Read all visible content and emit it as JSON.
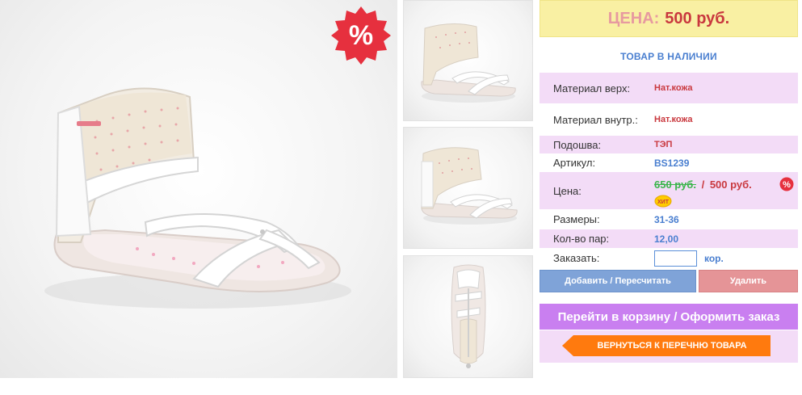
{
  "product": {
    "main_image_alt": "",
    "sale_badge_text": "%",
    "thumbnails": [
      "",
      "",
      ""
    ]
  },
  "price_box": {
    "label": "ЦЕНА:",
    "value": "500 руб."
  },
  "stock_status": "ТОВАР В НАЛИЧИИ",
  "properties": {
    "material_top": {
      "label": "Материал верх:",
      "value": "Нат.кожа"
    },
    "material_inner": {
      "label": "Материал внутр.:",
      "value": "Нат.кожа"
    },
    "sole": {
      "label": "Подошва:",
      "value": "ТЭП"
    },
    "article": {
      "label": "Артикул:",
      "value": "BS1239"
    },
    "price": {
      "label": "Цена:",
      "old": "650 руб.",
      "separator": "/",
      "new": "500 руб.",
      "hit_badge": "ХИТ",
      "sale_badge": "%"
    },
    "sizes": {
      "label": "Размеры:",
      "value": "31-36"
    },
    "pairs": {
      "label": "Кол-во пар:",
      "value": "12,00"
    },
    "order": {
      "label": "Заказать:",
      "input_value": "",
      "unit": "кор."
    }
  },
  "buttons": {
    "add": "Добавить / Пересчитать",
    "delete": "Удалить",
    "cart": "Перейти в корзину / Оформить заказ",
    "back": "ВЕРНУТЬСЯ К ПЕРЕЧНЮ ТОВАРА"
  },
  "colors": {
    "price_bg": "#f9f0a3",
    "accent_red": "#c9383e",
    "accent_blue": "#4a7fd0",
    "row_pink": "#f3dcf7",
    "cart_purple": "#c97ff0",
    "back_orange": "#ff7a0e"
  }
}
